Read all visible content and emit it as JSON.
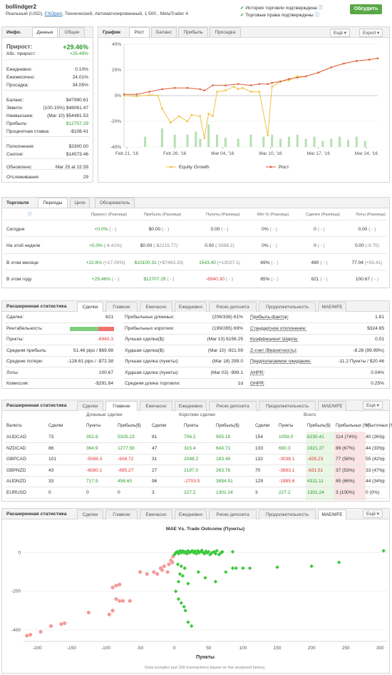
{
  "header": {
    "title": "bollindger2",
    "sub_prefix": "Реальный (USD), ",
    "broker": "FXOpen",
    "sub_suffix": ", Технический, Автоматизированный, 1:500 , MetaTrader 4",
    "check1": "История торговли подтверждена",
    "check2": "Торговые права подтверждены",
    "discuss": "Обсудить"
  },
  "info": {
    "title": "Инфо.",
    "tabs": [
      "Данные",
      "Общее"
    ],
    "gain_label": "Прирост:",
    "gain_value": "+29.46%",
    "abs_label": "Абс. прирост:",
    "abs_value": "+25.49%",
    "daily_label": "Ежедневно:",
    "daily_value": "0.10%",
    "monthly_label": "Ежемесячно:",
    "monthly_value": "24.01%",
    "dd_label": "Просадка:",
    "dd_value": "34.05%",
    "balance_label": "Баланс:",
    "balance_value": "$47990.61",
    "equity_label": "Эквити:",
    "equity_value": "(100.15%) $48061.47",
    "high_label": "Наивысшее:",
    "high_value": "(Mar 10) $54481.53",
    "profit_label": "Прибыль:",
    "profit_value": "$12707.29",
    "interest_label": "Процентная ставка:",
    "interest_value": "-$108.41",
    "deposits_label": "Пополнения:",
    "deposits_value": "$3300.00",
    "withdrawals_label": "Снятия:",
    "withdrawals_value": "$14573.46",
    "updated_label": "Обновлено:",
    "updated_value": "Mar 25 at 22:39",
    "tracking_label": "Отслеживания",
    "tracking_value": "29"
  },
  "graph": {
    "title": "График",
    "tabs": [
      "Рост",
      "Баланс",
      "Прибыль",
      "Просадка"
    ],
    "menu_btn": "Ещё",
    "export_btn": "Export"
  },
  "chart_data": [
    {
      "type": "line",
      "title": "",
      "xlabel": "",
      "ylabel": "",
      "x": [
        "Feb 21, '16",
        "Feb 26, '16",
        "Mar 04, '16",
        "Mar 10, '16",
        "Mar 17, '16",
        "Mar 24, '16"
      ],
      "yticks": [
        "40%",
        "20%",
        "0%",
        "-20%",
        "-40%"
      ],
      "ylim": [
        -40,
        40
      ],
      "series": [
        {
          "name": "Equity Growth",
          "color": "#f0c040",
          "points": [
            [
              0,
              0
            ],
            [
              3,
              -0.5
            ],
            [
              6,
              0.5
            ],
            [
              8,
              0
            ],
            [
              9,
              -10
            ],
            [
              11,
              -21
            ],
            [
              13,
              -16
            ],
            [
              15,
              -20
            ],
            [
              16,
              -15
            ],
            [
              18,
              -16
            ],
            [
              19,
              -33
            ],
            [
              20,
              -14
            ],
            [
              21,
              -16
            ],
            [
              22,
              3
            ],
            [
              24,
              4
            ],
            [
              26,
              7
            ],
            [
              27,
              5
            ],
            [
              28,
              6
            ],
            [
              30,
              3
            ],
            [
              32,
              3
            ],
            [
              34,
              -31
            ],
            [
              35,
              7
            ],
            [
              37,
              11
            ],
            [
              39,
              12
            ],
            [
              41,
              15
            ],
            [
              43,
              15
            ],
            [
              46,
              18
            ],
            [
              49,
              22
            ],
            [
              52,
              25
            ],
            [
              55,
              27
            ],
            [
              58,
              28
            ],
            [
              60,
              29
            ]
          ]
        },
        {
          "name": "Рост",
          "color": "#e06040",
          "points": [
            [
              0,
              1
            ],
            [
              3,
              1
            ],
            [
              6,
              3
            ],
            [
              9,
              5
            ],
            [
              12,
              6
            ],
            [
              15,
              6
            ],
            [
              18,
              5
            ],
            [
              19,
              4
            ],
            [
              21,
              8
            ],
            [
              24,
              8
            ],
            [
              27,
              9
            ],
            [
              30,
              8
            ],
            [
              32,
              9
            ],
            [
              34,
              9
            ],
            [
              35,
              10
            ],
            [
              37,
              11
            ],
            [
              39,
              13
            ],
            [
              41,
              14
            ],
            [
              43,
              15
            ],
            [
              46,
              18
            ],
            [
              49,
              22
            ],
            [
              52,
              25
            ],
            [
              55,
              27
            ],
            [
              58,
              28
            ],
            [
              60,
              29
            ]
          ]
        }
      ],
      "bars": [
        [
          5,
          0.1
        ],
        [
          9,
          0.18
        ],
        [
          12,
          0.12
        ],
        [
          15,
          0.12
        ],
        [
          17,
          0.15
        ],
        [
          18,
          0.08
        ],
        [
          20,
          0.22
        ],
        [
          22,
          0.12
        ],
        [
          24,
          0.09
        ],
        [
          27,
          0.08
        ],
        [
          30,
          0.12
        ],
        [
          33,
          0.1
        ],
        [
          35,
          0.12
        ],
        [
          37,
          0.08
        ],
        [
          39,
          0.1
        ],
        [
          41,
          0.12
        ],
        [
          43,
          0.08
        ],
        [
          45,
          0.1
        ],
        [
          47,
          0.06
        ],
        [
          49,
          0.08
        ],
        [
          51,
          0.1
        ],
        [
          53,
          0.07
        ],
        [
          55,
          0.1
        ],
        [
          57,
          0.06
        ]
      ]
    },
    {
      "type": "scatter",
      "title": "MAE Vs. Trade Outcome (Пункты)",
      "xlabel": "Пункты",
      "ylabel": "",
      "xticks": [
        "-200",
        "-150",
        "-100",
        "-50",
        "0",
        "50",
        "100",
        "150",
        "200",
        "250",
        "300"
      ],
      "yticks": [
        "0",
        "-200",
        "-400"
      ],
      "xlim": [
        -220,
        310
      ],
      "ylim": [
        -460,
        80
      ],
      "series": [
        {
          "name": "loss",
          "color": "#f49a9a",
          "points": [
            [
              -215,
              -430
            ],
            [
              -210,
              -425
            ],
            [
              -195,
              -410
            ],
            [
              -180,
              -380
            ],
            [
              -165,
              -370
            ],
            [
              -160,
              -365
            ],
            [
              -125,
              -310
            ],
            [
              -95,
              -320
            ],
            [
              -90,
              -300
            ],
            [
              -90,
              -180
            ],
            [
              -85,
              -170
            ],
            [
              -80,
              -165
            ],
            [
              -85,
              -240
            ],
            [
              -80,
              -250
            ],
            [
              -75,
              -250
            ],
            [
              -65,
              -250
            ],
            [
              -50,
              -100
            ],
            [
              -40,
              -110
            ],
            [
              -30,
              -100
            ],
            [
              -25,
              -110
            ],
            [
              -20,
              -80
            ],
            [
              -18,
              -90
            ],
            [
              -15,
              -70
            ],
            [
              -10,
              -100
            ],
            [
              -8,
              -60
            ],
            [
              -5,
              -40
            ],
            [
              -3,
              -50
            ],
            [
              -2,
              -20
            ]
          ]
        },
        {
          "name": "profit",
          "color": "#3cc83c",
          "points": [
            [
              0,
              -10
            ],
            [
              2,
              0
            ],
            [
              4,
              5
            ],
            [
              6,
              -5
            ],
            [
              8,
              10
            ],
            [
              10,
              0
            ],
            [
              12,
              10
            ],
            [
              14,
              0
            ],
            [
              16,
              5
            ],
            [
              18,
              -5
            ],
            [
              20,
              10
            ],
            [
              22,
              0
            ],
            [
              24,
              5
            ],
            [
              26,
              10
            ],
            [
              28,
              0
            ],
            [
              30,
              8
            ],
            [
              32,
              -5
            ],
            [
              34,
              10
            ],
            [
              36,
              0
            ],
            [
              38,
              5
            ],
            [
              40,
              12
            ],
            [
              42,
              0
            ],
            [
              44,
              -5
            ],
            [
              46,
              8
            ],
            [
              48,
              0
            ],
            [
              50,
              5
            ],
            [
              52,
              -10
            ],
            [
              55,
              0
            ],
            [
              58,
              5
            ],
            [
              60,
              -5
            ],
            [
              62,
              10
            ],
            [
              65,
              -10
            ],
            [
              68,
              0
            ],
            [
              70,
              5
            ],
            [
              5,
              -60
            ],
            [
              10,
              -70
            ],
            [
              15,
              -80
            ],
            [
              8,
              -110
            ],
            [
              12,
              -120
            ],
            [
              6,
              -150
            ],
            [
              20,
              -160
            ],
            [
              2,
              -200
            ],
            [
              6,
              -240
            ],
            [
              10,
              -260
            ],
            [
              14,
              -280
            ],
            [
              16,
              -300
            ],
            [
              20,
              -360
            ],
            [
              25,
              -380
            ],
            [
              35,
              -100
            ],
            [
              45,
              -130
            ],
            [
              60,
              -150
            ],
            [
              75,
              -100
            ],
            [
              85,
              -80
            ],
            [
              90,
              -80
            ],
            [
              100,
              -80
            ],
            [
              110,
              -80
            ],
            [
              150,
              -75
            ],
            [
              200,
              -70
            ],
            [
              240,
              -50
            ],
            [
              85,
              5
            ],
            [
              305,
              10
            ]
          ]
        }
      ],
      "footnote": "Data includes last 200 transactions based on the analysed history."
    }
  ],
  "trading": {
    "title": "Торговля",
    "tabs": [
      "Периоды",
      "Цели",
      "Обозреватель"
    ],
    "headers": [
      "Прирост (Разница)",
      "Прибыль (Разница)",
      "Пункты (Разница)",
      "Win % (Разница)",
      "Сделки (Разница)",
      "Лоты (Разница)"
    ],
    "rows": [
      {
        "label": "Сегодня",
        "gain": "+0.0%",
        "gain_d": "( - )",
        "profit": "$0.00",
        "profit_d": "( - )",
        "pips": "0.00",
        "pips_d": "( - )",
        "win": "0%",
        "win_d": "( - )",
        "trades": "0",
        "trades_d": "( - )",
        "lots": "0.00",
        "lots_d": "( - )"
      },
      {
        "label": "На этой неделе",
        "gain": "+0.0%",
        "gain_d": "(-4.41%)",
        "profit": "$0.00",
        "profit_d": "(-$2215.77)",
        "pips": "0.00",
        "pips_d": "(-3398.2)",
        "win": "0%",
        "win_d": "( - )",
        "trades": "0",
        "trades_d": "( - )",
        "lots": "0.00",
        "lots_d": "(-9.75)"
      },
      {
        "label": "В этом месяце",
        "gain": "+22.6%",
        "gain_d": "(+17.00%)",
        "profit": "$10100.31",
        "profit_d": "(+$7493.33)",
        "pips": "1543.40",
        "pips_d": "(+10027.1)",
        "win": "69%",
        "win_d": "( - )",
        "trades": "490",
        "trades_d": "( - )",
        "lots": "77.04",
        "lots_d": "(+53.41)"
      },
      {
        "label": "В этом году",
        "gain": "+29.46%",
        "gain_d": "( - )",
        "profit": "$12707.29",
        "profit_d": "( - )",
        "pips": "-6940.30",
        "pips_d": "( - )",
        "win": "65%",
        "win_d": "( - )",
        "trades": "621",
        "trades_d": "( - )",
        "lots": "100.67",
        "lots_d": "( - )"
      }
    ]
  },
  "stats1": {
    "title": "Расширенная статистика",
    "tabs": [
      "Сделки",
      "Главное",
      "Ежечасно",
      "Ежедневно",
      "Риски депозита",
      "Продолжительность",
      "MAE/MFE"
    ],
    "c1": [
      [
        "Сделки:",
        "621"
      ],
      [
        "Рентабельность:",
        ""
      ],
      [
        "Пункты:",
        "-6940.3"
      ],
      [
        "Средняя прибыль:",
        "51.46 pips / $69.98"
      ],
      [
        "Средние потери:",
        "-128.61 pips / -$72.38"
      ],
      [
        "Лоты:",
        "100.67"
      ],
      [
        "Комиссия:",
        "-$291.84"
      ]
    ],
    "c2": [
      [
        "Прибыльных длинных:",
        "(206/336) 61%"
      ],
      [
        "Прибыльных коротких:",
        "(199/285) 69%"
      ],
      [
        "Лучшая сделка($):",
        "(Mar 10) 6156.25"
      ],
      [
        "Худшая сделка($):",
        "(Mar 10) -921.09"
      ],
      [
        "Лучшая сделка (пункты):",
        "(Mar 18) 299.0"
      ],
      [
        "Худшая сделка (пункты):",
        "(Mar 02) -999.1"
      ],
      [
        "Средняя длина торговли:",
        "1d"
      ]
    ],
    "c3": [
      [
        "Прибыль-фактор:",
        "1.81"
      ],
      [
        "Стандартное отклонение:",
        "$324.65"
      ],
      [
        "Коэффициент Шарпа:",
        "0.01"
      ],
      [
        "Z-счет (Вероятность):",
        "-8.26 (99.99%)"
      ],
      [
        "Предполагаемое ожидание:",
        "-11.2 Пункты / $20.46"
      ],
      [
        "AHPR:",
        "0.04%"
      ],
      [
        "GHPR:",
        "0.25%"
      ]
    ],
    "profit_share": 0.65
  },
  "stats2": {
    "title": "Расширенная статистика",
    "tabs": [
      "Сделки",
      "Главное",
      "Ежечасно",
      "Ежедневно",
      "Риски депозита",
      "Продолжительность",
      "MAE/MFE"
    ],
    "menu_btn": "Ещё",
    "group_long": "Длинные сделки",
    "group_short": "Короткие сделки",
    "group_all": "Всего",
    "headers": [
      "Валюта",
      "Сделки",
      "Пункты",
      "Прибыль($)",
      "Сделки",
      "Пункты",
      "Прибыль($)",
      "Сделки",
      "Пункты",
      "Прибыль($)",
      "Прибыльных (%)",
      "Убыточных (%)"
    ],
    "rows": [
      [
        "AUDCAD",
        "73",
        "352.8",
        "5325.23",
        "81",
        "706.2",
        "905.18",
        "154",
        "1059.0",
        "6230.41",
        "114 (74%)",
        "40 (26%)"
      ],
      [
        "NZDCAD",
        "86",
        "364.9",
        "1277.56",
        "47",
        "315.4",
        "643.71",
        "133",
        "680.3",
        "1921.27",
        "89 (67%)",
        "44 (33%)"
      ],
      [
        "GBPCAD",
        "101",
        "-5086.3",
        "-608.72",
        "31",
        "2048.2",
        "183.49",
        "132",
        "-3038.1",
        "-425.23",
        "77 (58%)",
        "55 (42%)"
      ],
      [
        "GBPNZD",
        "43",
        "-6080.1",
        "-895.27",
        "27",
        "2197.0",
        "263.76",
        "70",
        "-3883.1",
        "-631.51",
        "37 (53%)",
        "33 (47%)"
      ],
      [
        "AUDNZD",
        "33",
        "717.9",
        "456.60",
        "96",
        "-2703.5",
        "3854.51",
        "129",
        "-1985.6",
        "4311.11",
        "85 (66%)",
        "44 (34%)"
      ],
      [
        "EURUSD",
        "0",
        "0",
        "0",
        "3",
        "227.2",
        "1301.24",
        "3",
        "227.2",
        "1301.24",
        "3 (100%)",
        "0 (0%)"
      ]
    ]
  },
  "stats3": {
    "title": "Расширенная статистика",
    "tabs": [
      "Сделки",
      "Главное",
      "Ежечасно",
      "Ежедневно",
      "Риски депозита",
      "Продолжительность",
      "MAE/MFE"
    ],
    "menu_btn": "Ещё"
  }
}
